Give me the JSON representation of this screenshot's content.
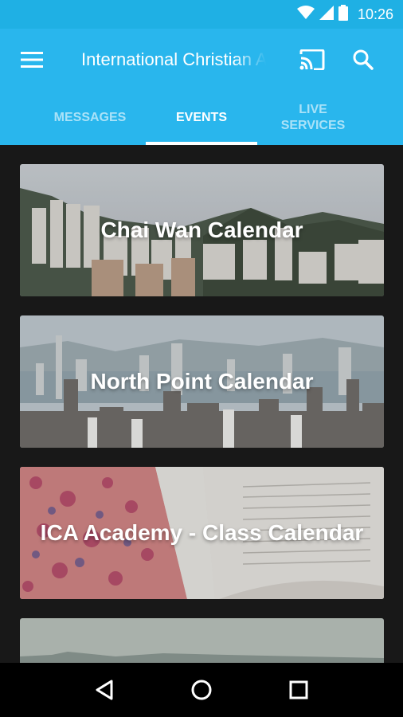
{
  "status_bar": {
    "time": "10:26",
    "icons": [
      "wifi-icon",
      "signal-icon",
      "battery-icon"
    ]
  },
  "app_bar": {
    "title": "International Christian Assembly",
    "menu_icon": "menu-icon",
    "cast_icon": "cast-icon",
    "search_icon": "search-icon"
  },
  "tabs": [
    {
      "label": "MESSAGES",
      "active": false
    },
    {
      "label": "EVENTS",
      "active": true
    },
    {
      "label": "LIVE SERVICES",
      "active": false
    }
  ],
  "calendars": [
    {
      "label": "Chai Wan Calendar"
    },
    {
      "label": "North Point Calendar"
    },
    {
      "label": "ICA Academy - Class Calendar"
    },
    {
      "label": ""
    }
  ],
  "nav_bar": {
    "back_icon": "back-icon",
    "home_icon": "home-icon",
    "recents_icon": "recents-icon"
  },
  "colors": {
    "primary": "#29b6ed",
    "status_bar": "#1fb0e4",
    "background": "#181818"
  }
}
